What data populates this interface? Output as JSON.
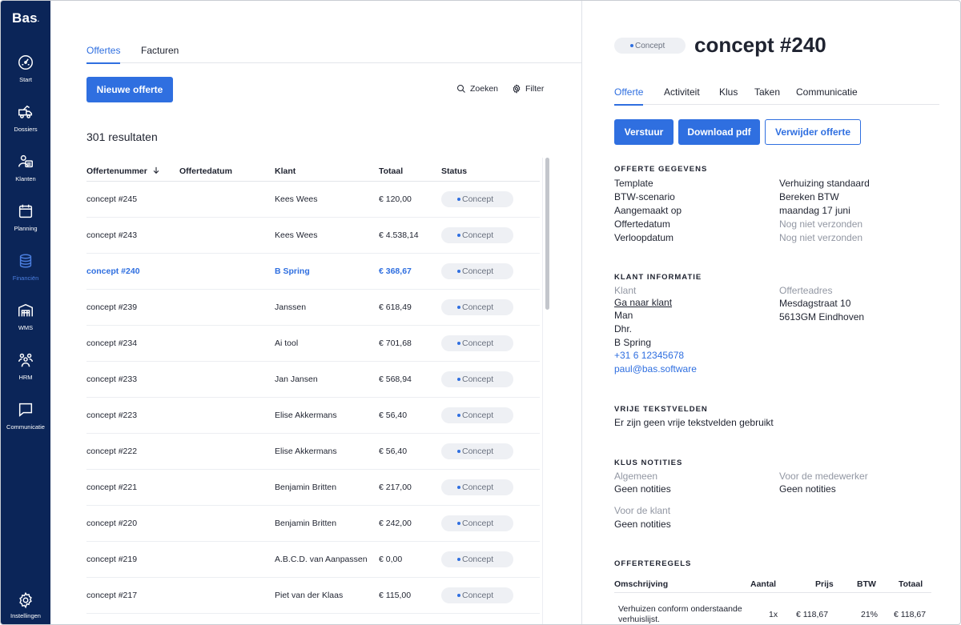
{
  "app": {
    "logo": "Bas",
    "logo_dot": "."
  },
  "nav": [
    {
      "label": "Start",
      "icon": "gauge-icon"
    },
    {
      "label": "Dossiers",
      "icon": "truck-icon"
    },
    {
      "label": "Klanten",
      "icon": "people-icon"
    },
    {
      "label": "Planning",
      "icon": "calendar-icon"
    },
    {
      "label": "Financiën",
      "icon": "coins-icon",
      "active": true
    },
    {
      "label": "WMS",
      "icon": "warehouse-icon"
    },
    {
      "label": "HRM",
      "icon": "team-icon"
    },
    {
      "label": "Communicatie",
      "icon": "chat-icon"
    },
    {
      "label": "Instellingen",
      "icon": "gear-icon"
    }
  ],
  "list": {
    "tabs": [
      "Offertes",
      "Facturen"
    ],
    "new_button": "Nieuwe offerte",
    "search_label": "Zoeken",
    "filter_label": "Filter",
    "results": "301 resultaten",
    "columns": [
      "Offertenummer",
      "Offertedatum",
      "Klant",
      "Totaal",
      "Status"
    ],
    "rows": [
      {
        "nr": "concept #245",
        "date": "",
        "klant": "Kees Wees",
        "totaal": "€ 120,00",
        "status": "Concept"
      },
      {
        "nr": "concept #243",
        "date": "",
        "klant": "Kees Wees",
        "totaal": "€ 4.538,14",
        "status": "Concept"
      },
      {
        "nr": "concept #240",
        "date": "",
        "klant": "B Spring",
        "totaal": "€ 368,67",
        "status": "Concept",
        "selected": true
      },
      {
        "nr": "concept #239",
        "date": "",
        "klant": "Janssen",
        "totaal": "€ 618,49",
        "status": "Concept"
      },
      {
        "nr": "concept #234",
        "date": "",
        "klant": "Ai tool",
        "totaal": "€ 701,68",
        "status": "Concept"
      },
      {
        "nr": "concept #233",
        "date": "",
        "klant": "Jan Jansen",
        "totaal": "€ 568,94",
        "status": "Concept"
      },
      {
        "nr": "concept #223",
        "date": "",
        "klant": "Elise Akkermans",
        "totaal": "€ 56,40",
        "status": "Concept"
      },
      {
        "nr": "concept #222",
        "date": "",
        "klant": "Elise Akkermans",
        "totaal": "€ 56,40",
        "status": "Concept"
      },
      {
        "nr": "concept #221",
        "date": "",
        "klant": "Benjamin Britten",
        "totaal": "€ 217,00",
        "status": "Concept"
      },
      {
        "nr": "concept #220",
        "date": "",
        "klant": "Benjamin Britten",
        "totaal": "€ 242,00",
        "status": "Concept"
      },
      {
        "nr": "concept #219",
        "date": "",
        "klant": "A.B.C.D. van Aanpassen",
        "totaal": "€ 0,00",
        "status": "Concept"
      },
      {
        "nr": "concept #217",
        "date": "",
        "klant": "Piet van der Klaas",
        "totaal": "€ 115,00",
        "status": "Concept"
      }
    ]
  },
  "detail": {
    "status": "Concept",
    "title": "concept #240",
    "tabs": [
      "Offerte",
      "Activiteit",
      "Klus",
      "Taken",
      "Communicatie"
    ],
    "buttons": {
      "send": "Verstuur",
      "download": "Download pdf",
      "delete": "Verwijder offerte"
    },
    "offerte": {
      "title": "OFFERTE GEGEVENS",
      "rows": [
        {
          "k": "Template",
          "v": "Verhuizing standaard"
        },
        {
          "k": "BTW-scenario",
          "v": "Bereken BTW"
        },
        {
          "k": "Aangemaakt op",
          "v": "maandag 17 juni"
        },
        {
          "k": "Offertedatum",
          "v": "Nog niet verzonden"
        },
        {
          "k": "Verloopdatum",
          "v": "Nog niet verzonden"
        }
      ]
    },
    "klant": {
      "title": "KLANT INFORMATIE",
      "label": "Klant",
      "link": "Ga naar klant",
      "lines": [
        "Man",
        "Dhr.",
        "B Spring"
      ],
      "phone": "+31 6 12345678",
      "email": "paul@bas.software",
      "addr_label": "Offerteadres",
      "addr_lines": [
        "Mesdagstraat 10",
        "5613GM Eindhoven"
      ]
    },
    "vrije": {
      "title": "VRIJE TEKSTVELDEN",
      "text": "Er zijn geen vrije tekstvelden gebruikt"
    },
    "notities": {
      "title": "KLUS NOTITIES",
      "algemeen_label": "Algemeen",
      "algemeen": "Geen notities",
      "medewerker_label": "Voor de medewerker",
      "medewerker": "Geen notities",
      "klant_label": "Voor de klant",
      "klant": "Geen notities"
    },
    "regels": {
      "title": "OFFERTEREGELS",
      "columns": [
        "Omschrijving",
        "Aantal",
        "Prijs",
        "BTW",
        "Totaal"
      ],
      "rows": [
        {
          "omschrijving_1": "Verhuizen conform onderstaande",
          "omschrijving_2": "verhuislijst.",
          "aantal": "1x",
          "prijs": "€ 118,67",
          "btw": "21%",
          "totaal": "€ 118,67"
        }
      ]
    }
  }
}
